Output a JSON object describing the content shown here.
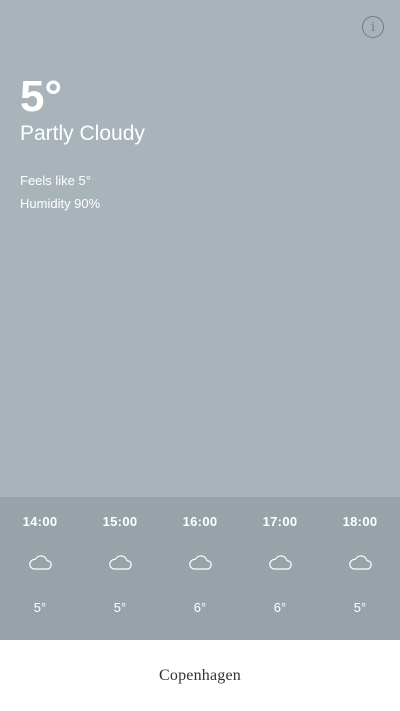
{
  "current": {
    "temperature": "5°",
    "condition": "Partly Cloudy",
    "feels_like": "Feels like 5°",
    "humidity": "Humidity 90%",
    "info_icon": "i"
  },
  "hourly": [
    {
      "time": "14:00",
      "icon": "cloud-icon",
      "temp": "5°"
    },
    {
      "time": "15:00",
      "icon": "cloud-icon",
      "temp": "5°"
    },
    {
      "time": "16:00",
      "icon": "cloud-icon",
      "temp": "6°"
    },
    {
      "time": "17:00",
      "icon": "cloud-icon",
      "temp": "6°"
    },
    {
      "time": "18:00",
      "icon": "cloud-icon",
      "temp": "5°"
    }
  ],
  "city": {
    "name": "Copenhagen"
  },
  "colors": {
    "current_bg": "#a9b4ba",
    "hourly_bg": "#97a2a9",
    "text": "#ffffff",
    "city_bg": "#ffffff"
  }
}
